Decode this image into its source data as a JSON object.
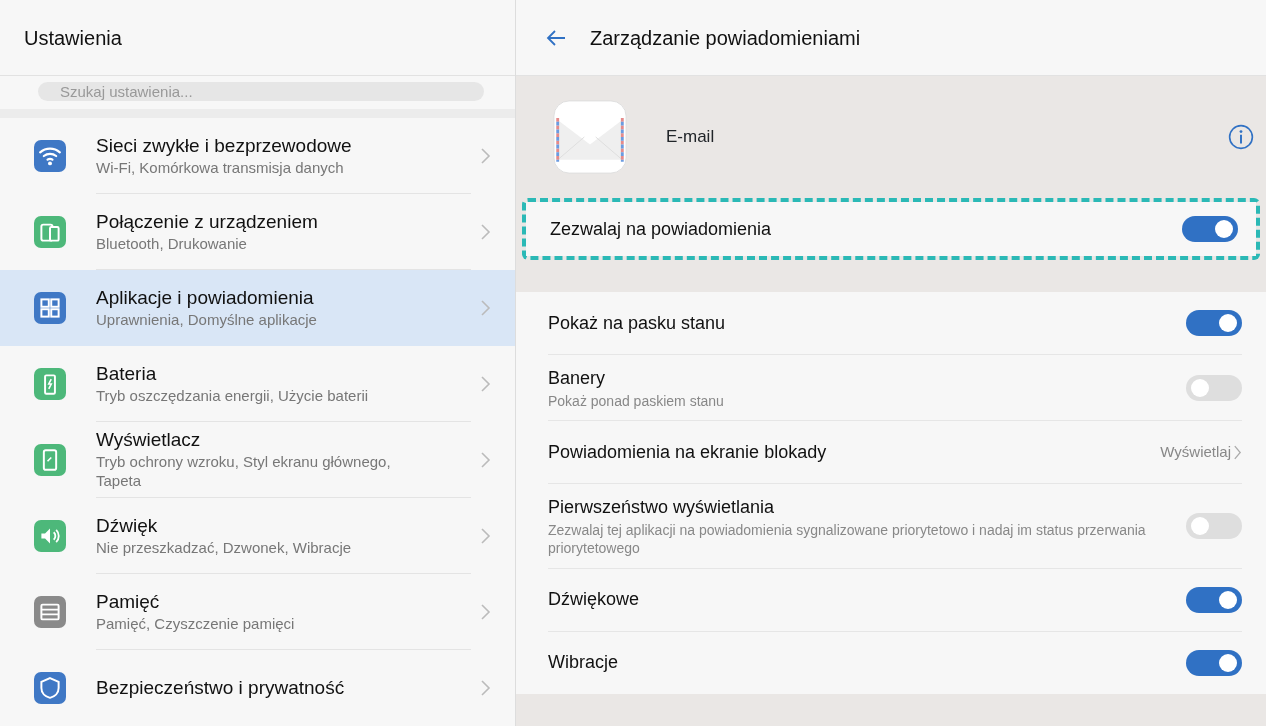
{
  "sidebar": {
    "title": "Ustawienia",
    "search": {
      "placeholder": "Szukaj ustawienia..."
    },
    "items": [
      {
        "title": "Sieci zwykłe i bezprzewodowe",
        "subtitle": "Wi-Fi, Komórkowa transmisja danych",
        "selected": false
      },
      {
        "title": "Połączenie z urządzeniem",
        "subtitle": "Bluetooth, Drukowanie",
        "selected": false
      },
      {
        "title": "Aplikacje i powiadomienia",
        "subtitle": "Uprawnienia, Domyślne aplikacje",
        "selected": true
      },
      {
        "title": "Bateria",
        "subtitle": "Tryb oszczędzania energii, Użycie baterii",
        "selected": false
      },
      {
        "title": "Wyświetlacz",
        "subtitle": "Tryb ochrony wzroku, Styl ekranu głównego, Tapeta",
        "selected": false
      },
      {
        "title": "Dźwięk",
        "subtitle": "Nie przeszkadzać, Dzwonek, Wibracje",
        "selected": false
      },
      {
        "title": "Pamięć",
        "subtitle": "Pamięć, Czyszczenie pamięci",
        "selected": false
      },
      {
        "title": "Bezpieczeństwo i prywatność",
        "selected": false
      }
    ]
  },
  "detail": {
    "title": "Zarządzanie powiadomieniami",
    "app": {
      "name": "E-mail"
    },
    "main_toggle": {
      "label": "Zezwalaj na powiadomienia",
      "on": true,
      "highlighted": true
    },
    "settings": [
      {
        "kind": "switch",
        "label": "Pokaż na pasku stanu",
        "on": true
      },
      {
        "kind": "switch",
        "label": "Banery",
        "subtitle": "Pokaż ponad paskiem stanu",
        "on": false
      },
      {
        "kind": "link",
        "label": "Powiadomienia na ekranie blokady",
        "value": "Wyświetlaj"
      },
      {
        "kind": "switch",
        "label": "Pierwszeństwo wyświetlania",
        "subtitle": "Zezwalaj tej aplikacji na powiadomienia sygnalizowane priorytetowo i nadaj im status przerwania priorytetowego",
        "on": false
      },
      {
        "kind": "switch",
        "label": "Dźwiękowe",
        "on": true
      },
      {
        "kind": "switch",
        "label": "Wibracje",
        "on": true
      }
    ]
  }
}
